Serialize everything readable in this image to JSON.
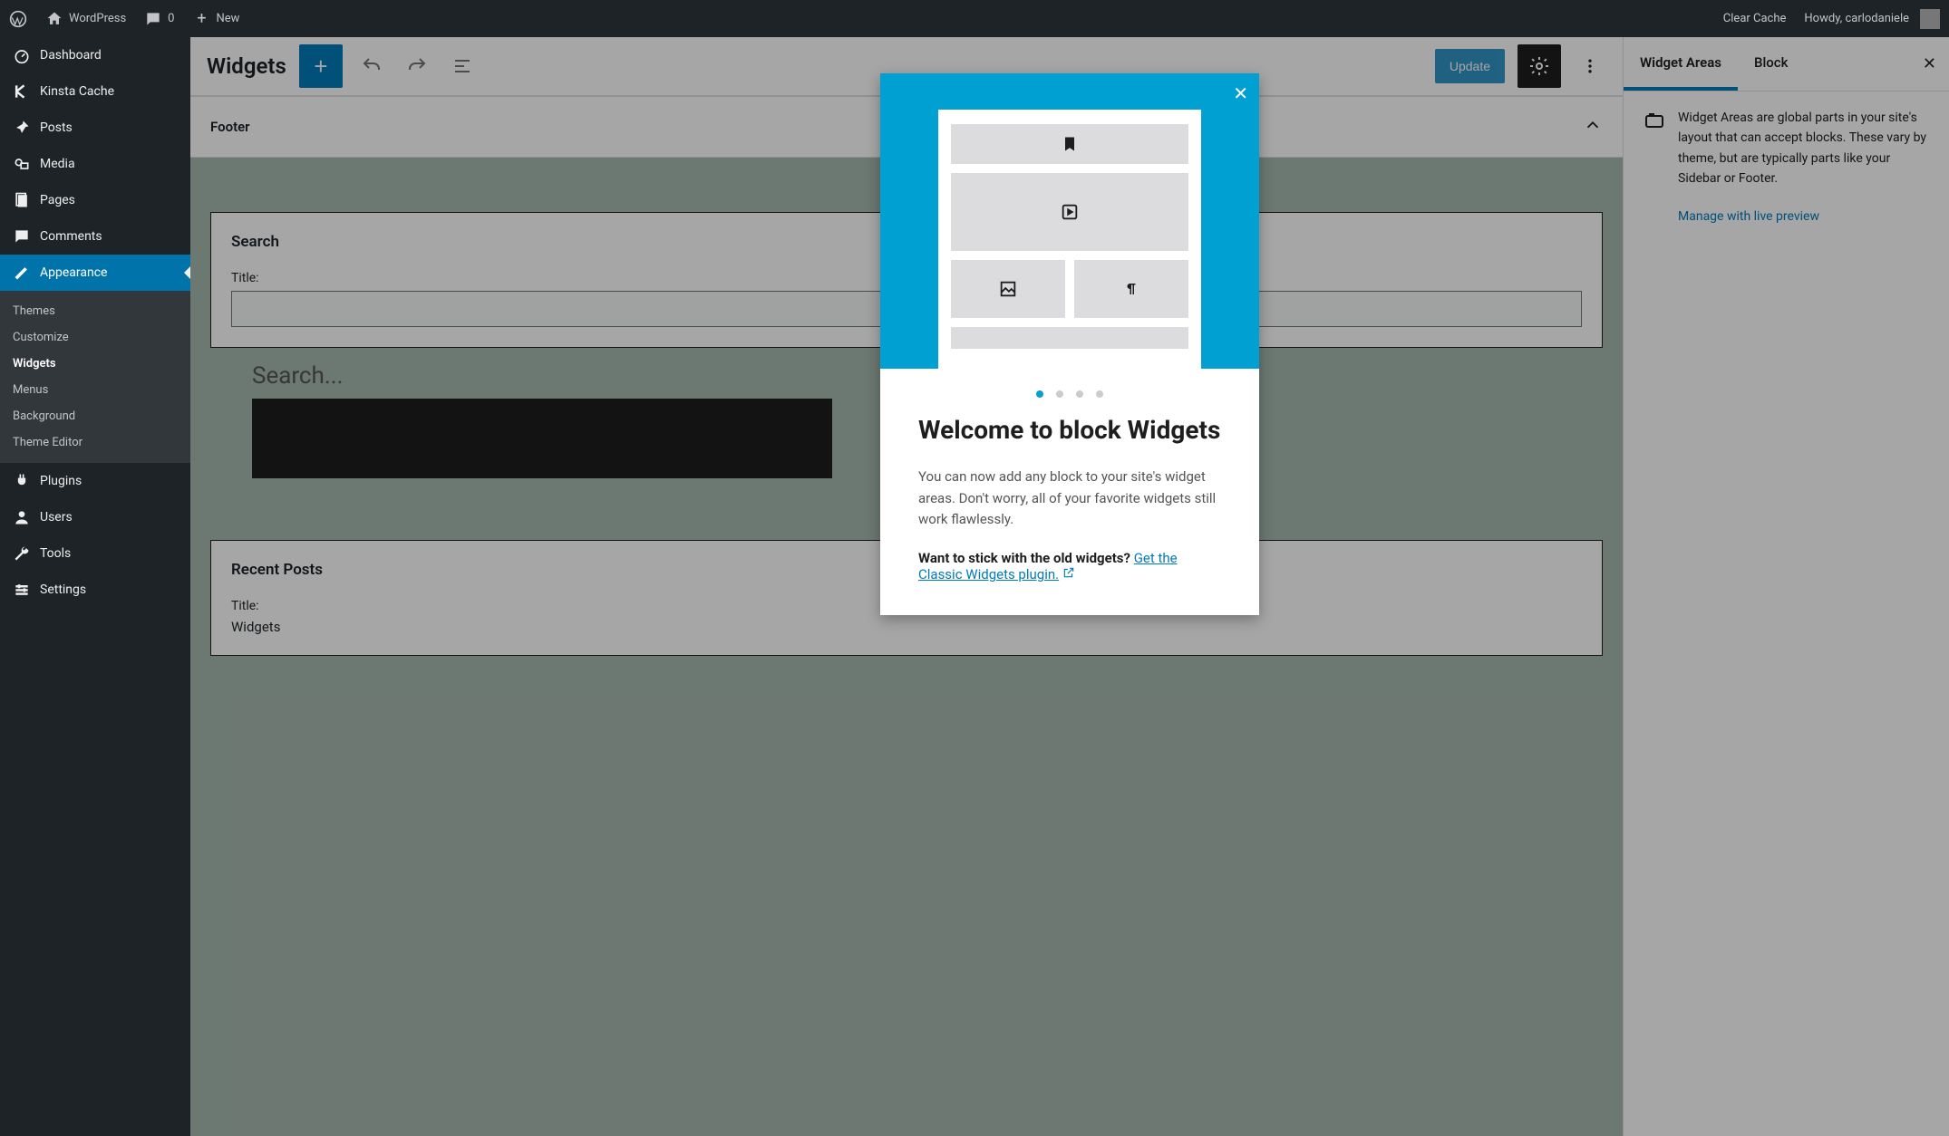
{
  "toolbar": {
    "site_name": "WordPress",
    "comments_count": "0",
    "new_label": "New",
    "clear_cache": "Clear Cache",
    "howdy": "Howdy, carlodaniele"
  },
  "sidebar": {
    "items": [
      {
        "label": "Dashboard"
      },
      {
        "label": "Kinsta Cache"
      },
      {
        "label": "Posts"
      },
      {
        "label": "Media"
      },
      {
        "label": "Pages"
      },
      {
        "label": "Comments"
      },
      {
        "label": "Appearance"
      },
      {
        "label": "Plugins"
      },
      {
        "label": "Users"
      },
      {
        "label": "Tools"
      },
      {
        "label": "Settings"
      }
    ],
    "appearance_submenu": [
      {
        "label": "Themes"
      },
      {
        "label": "Customize"
      },
      {
        "label": "Widgets"
      },
      {
        "label": "Menus"
      },
      {
        "label": "Background"
      },
      {
        "label": "Theme Editor"
      }
    ]
  },
  "header": {
    "title": "Widgets",
    "update": "Update"
  },
  "canvas": {
    "area_name": "Footer",
    "widgets": [
      {
        "title": "Search",
        "field_label": "Title:",
        "placeholder": "Search..."
      },
      {
        "title": "Recent Posts",
        "field_label": "Title:",
        "value": "Widgets"
      }
    ]
  },
  "right_panel": {
    "tabs": [
      {
        "label": "Widget Areas",
        "active": true
      },
      {
        "label": "Block",
        "active": false
      }
    ],
    "description": "Widget Areas are global parts in your site's layout that can accept blocks. These vary by theme, but are typically parts like your Sidebar or Footer.",
    "link": "Manage with live preview"
  },
  "modal": {
    "title": "Welcome to block Widgets",
    "text": "You can now add any block to your site's widget areas. Don't worry, all of your favorite widgets still work flawlessly.",
    "stick_prompt": "Want to stick with the old widgets? ",
    "link": "Get the Classic Widgets plugin.",
    "dots": 4,
    "active_dot": 0
  }
}
